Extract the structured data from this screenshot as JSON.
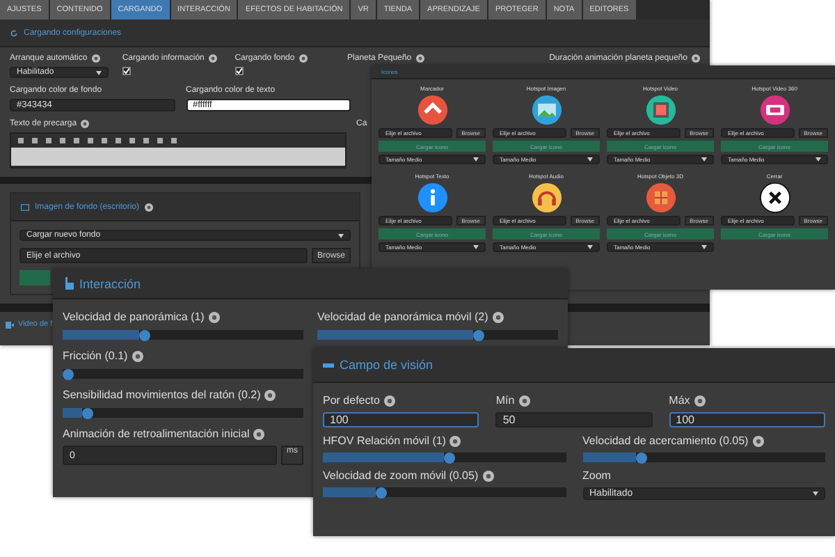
{
  "tabs": [
    {
      "label": "AJUSTES",
      "selected": false
    },
    {
      "label": "CONTENIDO",
      "selected": false
    },
    {
      "label": "CARGANDO",
      "selected": true
    },
    {
      "label": "INTERACCIÓN",
      "selected": false
    },
    {
      "label": "EFECTOS DE HABITACIÓN",
      "selected": false
    },
    {
      "label": "VR",
      "selected": false
    },
    {
      "label": "TIENDA",
      "selected": false
    },
    {
      "label": "APRENDIZAJE",
      "selected": false
    },
    {
      "label": "PROTEGER",
      "selected": false
    },
    {
      "label": "NOTA",
      "selected": false
    },
    {
      "label": "EDITORES",
      "selected": false
    }
  ],
  "loading": {
    "title": "Cargando configuraciones",
    "autostart": {
      "label": "Arranque automático",
      "value": "Habilitado"
    },
    "checks": [
      {
        "label": "Cargando información",
        "checked": true
      },
      {
        "label": "Cargando fondo",
        "checked": true
      }
    ],
    "side_labels": [
      "Planeta Pequeño",
      "Duración animación planeta pequeño"
    ],
    "colors": [
      {
        "label": "Cargando color de fondo",
        "value": "#343434",
        "light": false
      },
      {
        "label": "Cargando color de texto",
        "value": "#ffffff",
        "light": true
      }
    ],
    "preload_label": "Texto de precarga",
    "cut_label": "Ca"
  },
  "background": {
    "title": "Imagen de fondo (escritorio)",
    "select": "Cargar nuevo fondo",
    "file": "Elije el archivo",
    "browse": "Browse",
    "video_title": "Video de f"
  },
  "icons": {
    "title": "Iconos",
    "cards": [
      {
        "label": "Marcador",
        "kind": "chevron",
        "color": "#e8533f",
        "file": "Elije el archivo",
        "browse": "Browse",
        "upload": "Cargar icono",
        "size": "Tamaño Medio"
      },
      {
        "label": "Hotspot Imagen",
        "kind": "image",
        "color": "#2fa3d9",
        "file": "Elije el archivo",
        "browse": "Browse",
        "upload": "Cargar icono",
        "size": "Tamaño Medio"
      },
      {
        "label": "Hotspot Video",
        "kind": "video",
        "color": "#26b99a",
        "file": "Elije el archivo",
        "browse": "Browse",
        "upload": "Cargar icono",
        "size": "Tamaño Medio"
      },
      {
        "label": "Hotspot Video 360",
        "kind": "video360",
        "color": "#d6317d",
        "file": "Elije el archivo",
        "browse": "Browse",
        "upload": "Cargar icono",
        "size": "Tamaño Medio"
      },
      {
        "label": "Hotspot Texto",
        "kind": "info",
        "color": "#1e90ff",
        "file": "Elije el archivo",
        "browse": "Browse",
        "upload": "Cargar icono",
        "size": "Tamaño Medio"
      },
      {
        "label": "Hotspot Audio",
        "kind": "audio",
        "color": "#f5c04a",
        "file": "Elije el archivo",
        "browse": "Browse",
        "upload": "Cargar icono",
        "size": "Tamaño Medio"
      },
      {
        "label": "Hotspot Objeto 3D",
        "kind": "cube",
        "color": "#e55b3c",
        "file": "Elije el archivo",
        "browse": "Browse",
        "upload": "Cargar icono",
        "size": "Tamaño Medio"
      },
      {
        "label": "Cerrar",
        "kind": "close",
        "color": "#ffffff",
        "file": "Elije el archivo",
        "browse": "Browse",
        "upload": "Cargar icono"
      }
    ]
  },
  "interaction": {
    "title": "Interacción",
    "sliders": [
      {
        "label": "Velocidad de panorámica (1)",
        "level": 0.32
      },
      {
        "label": "Velocidad de panorámica móvil (2)",
        "level": 0.65
      },
      {
        "label": "Fricción (0.1)",
        "level": 0.0
      },
      {
        "label": "Sensibilidad movimientos del ratón (0.2)",
        "level": 0.08
      }
    ],
    "animation": {
      "label": "Animación de retroalimentación inicial",
      "value": "0",
      "unit": "ms"
    }
  },
  "fov": {
    "title": "Campo de visión",
    "inputs": [
      {
        "label": "Por defecto",
        "value": "100",
        "focused": true
      },
      {
        "label": "Mín",
        "value": "50",
        "focused": false
      },
      {
        "label": "Máx",
        "value": "100",
        "focused": true
      }
    ],
    "sliders": [
      {
        "label": "HFOV Relación móvil (1)",
        "level": 0.5
      },
      {
        "label": "Velocidad de acercamiento (0.05)",
        "level": 0.22
      },
      {
        "label": "Velocidad de zoom móvil (0.05)",
        "level": 0.22
      }
    ],
    "zoom": {
      "label": "Zoom",
      "value": "Habilitado"
    }
  }
}
